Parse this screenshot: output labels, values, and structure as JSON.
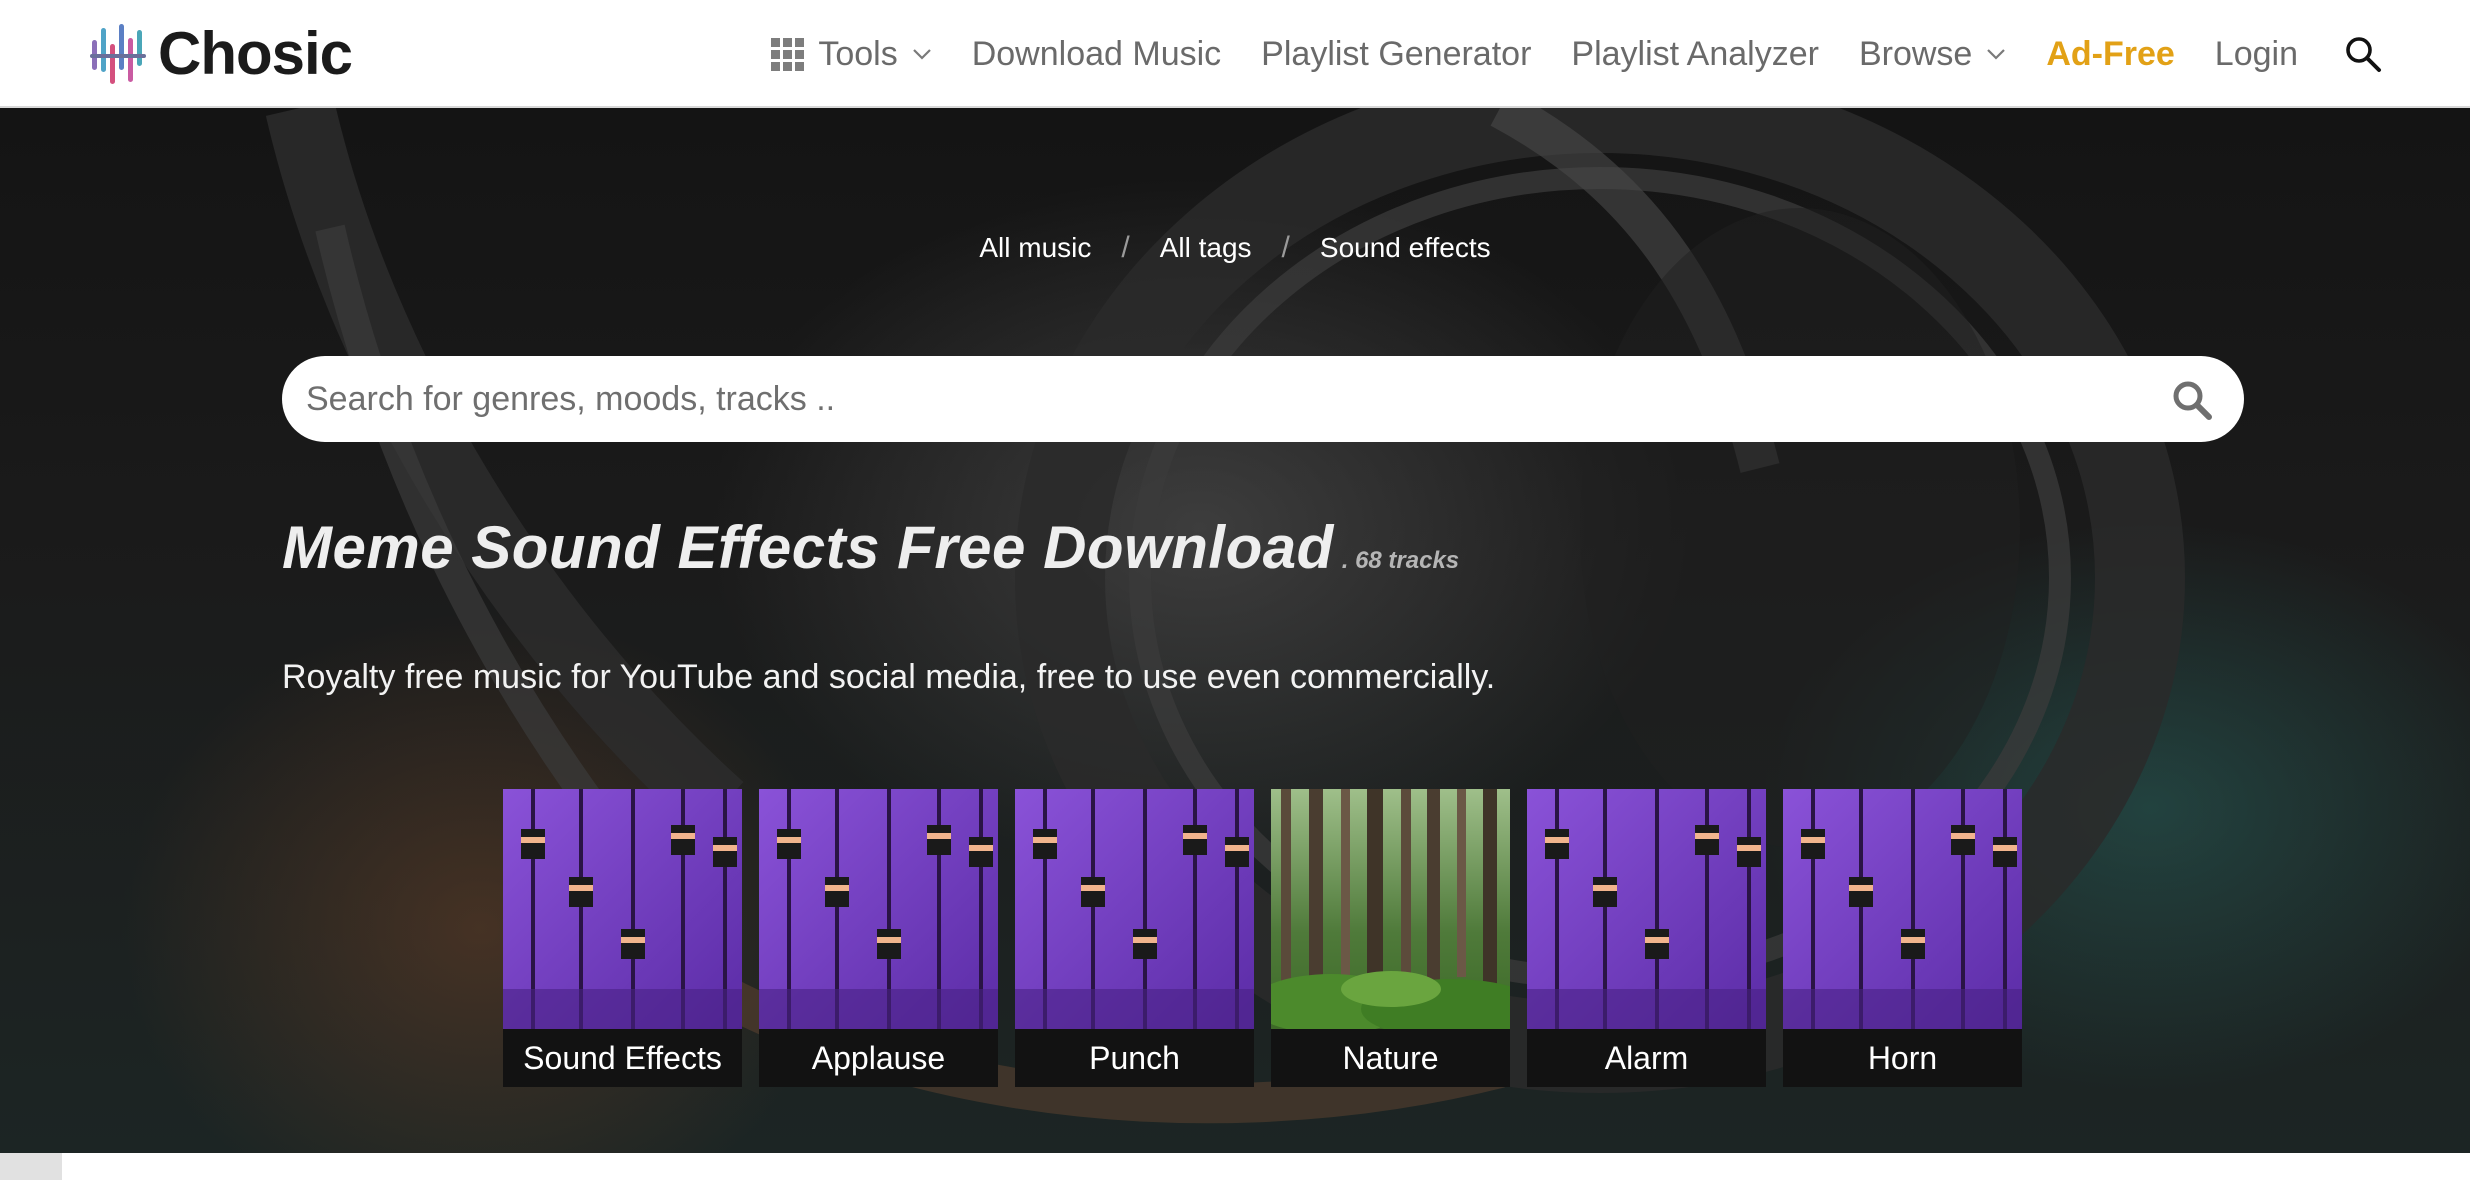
{
  "header": {
    "logo_text": "Chosic",
    "nav": {
      "tools": "Tools",
      "download_music": "Download Music",
      "playlist_generator": "Playlist Generator",
      "playlist_analyzer": "Playlist Analyzer",
      "browse": "Browse",
      "ad_free": "Ad-Free",
      "login": "Login"
    },
    "accent_color": "#e2a116"
  },
  "breadcrumb": {
    "items": [
      "All music",
      "All tags",
      "Sound effects"
    ],
    "separator": "/"
  },
  "search": {
    "placeholder": "Search for genres, moods, tracks .."
  },
  "page": {
    "title": "Meme Sound Effects Free Download",
    "track_count": ". 68 tracks",
    "subtitle": "Royalty free music for YouTube and social media, free to use even commercially."
  },
  "tiles": [
    {
      "label": "Sound Effects",
      "image": "mixer"
    },
    {
      "label": "Applause",
      "image": "mixer"
    },
    {
      "label": "Punch",
      "image": "mixer"
    },
    {
      "label": "Nature",
      "image": "forest"
    },
    {
      "label": "Alarm",
      "image": "mixer"
    },
    {
      "label": "Horn",
      "image": "mixer"
    }
  ],
  "icons": {
    "grid": "grid-icon",
    "chevron": "chevron-down-icon",
    "search": "search-icon"
  }
}
